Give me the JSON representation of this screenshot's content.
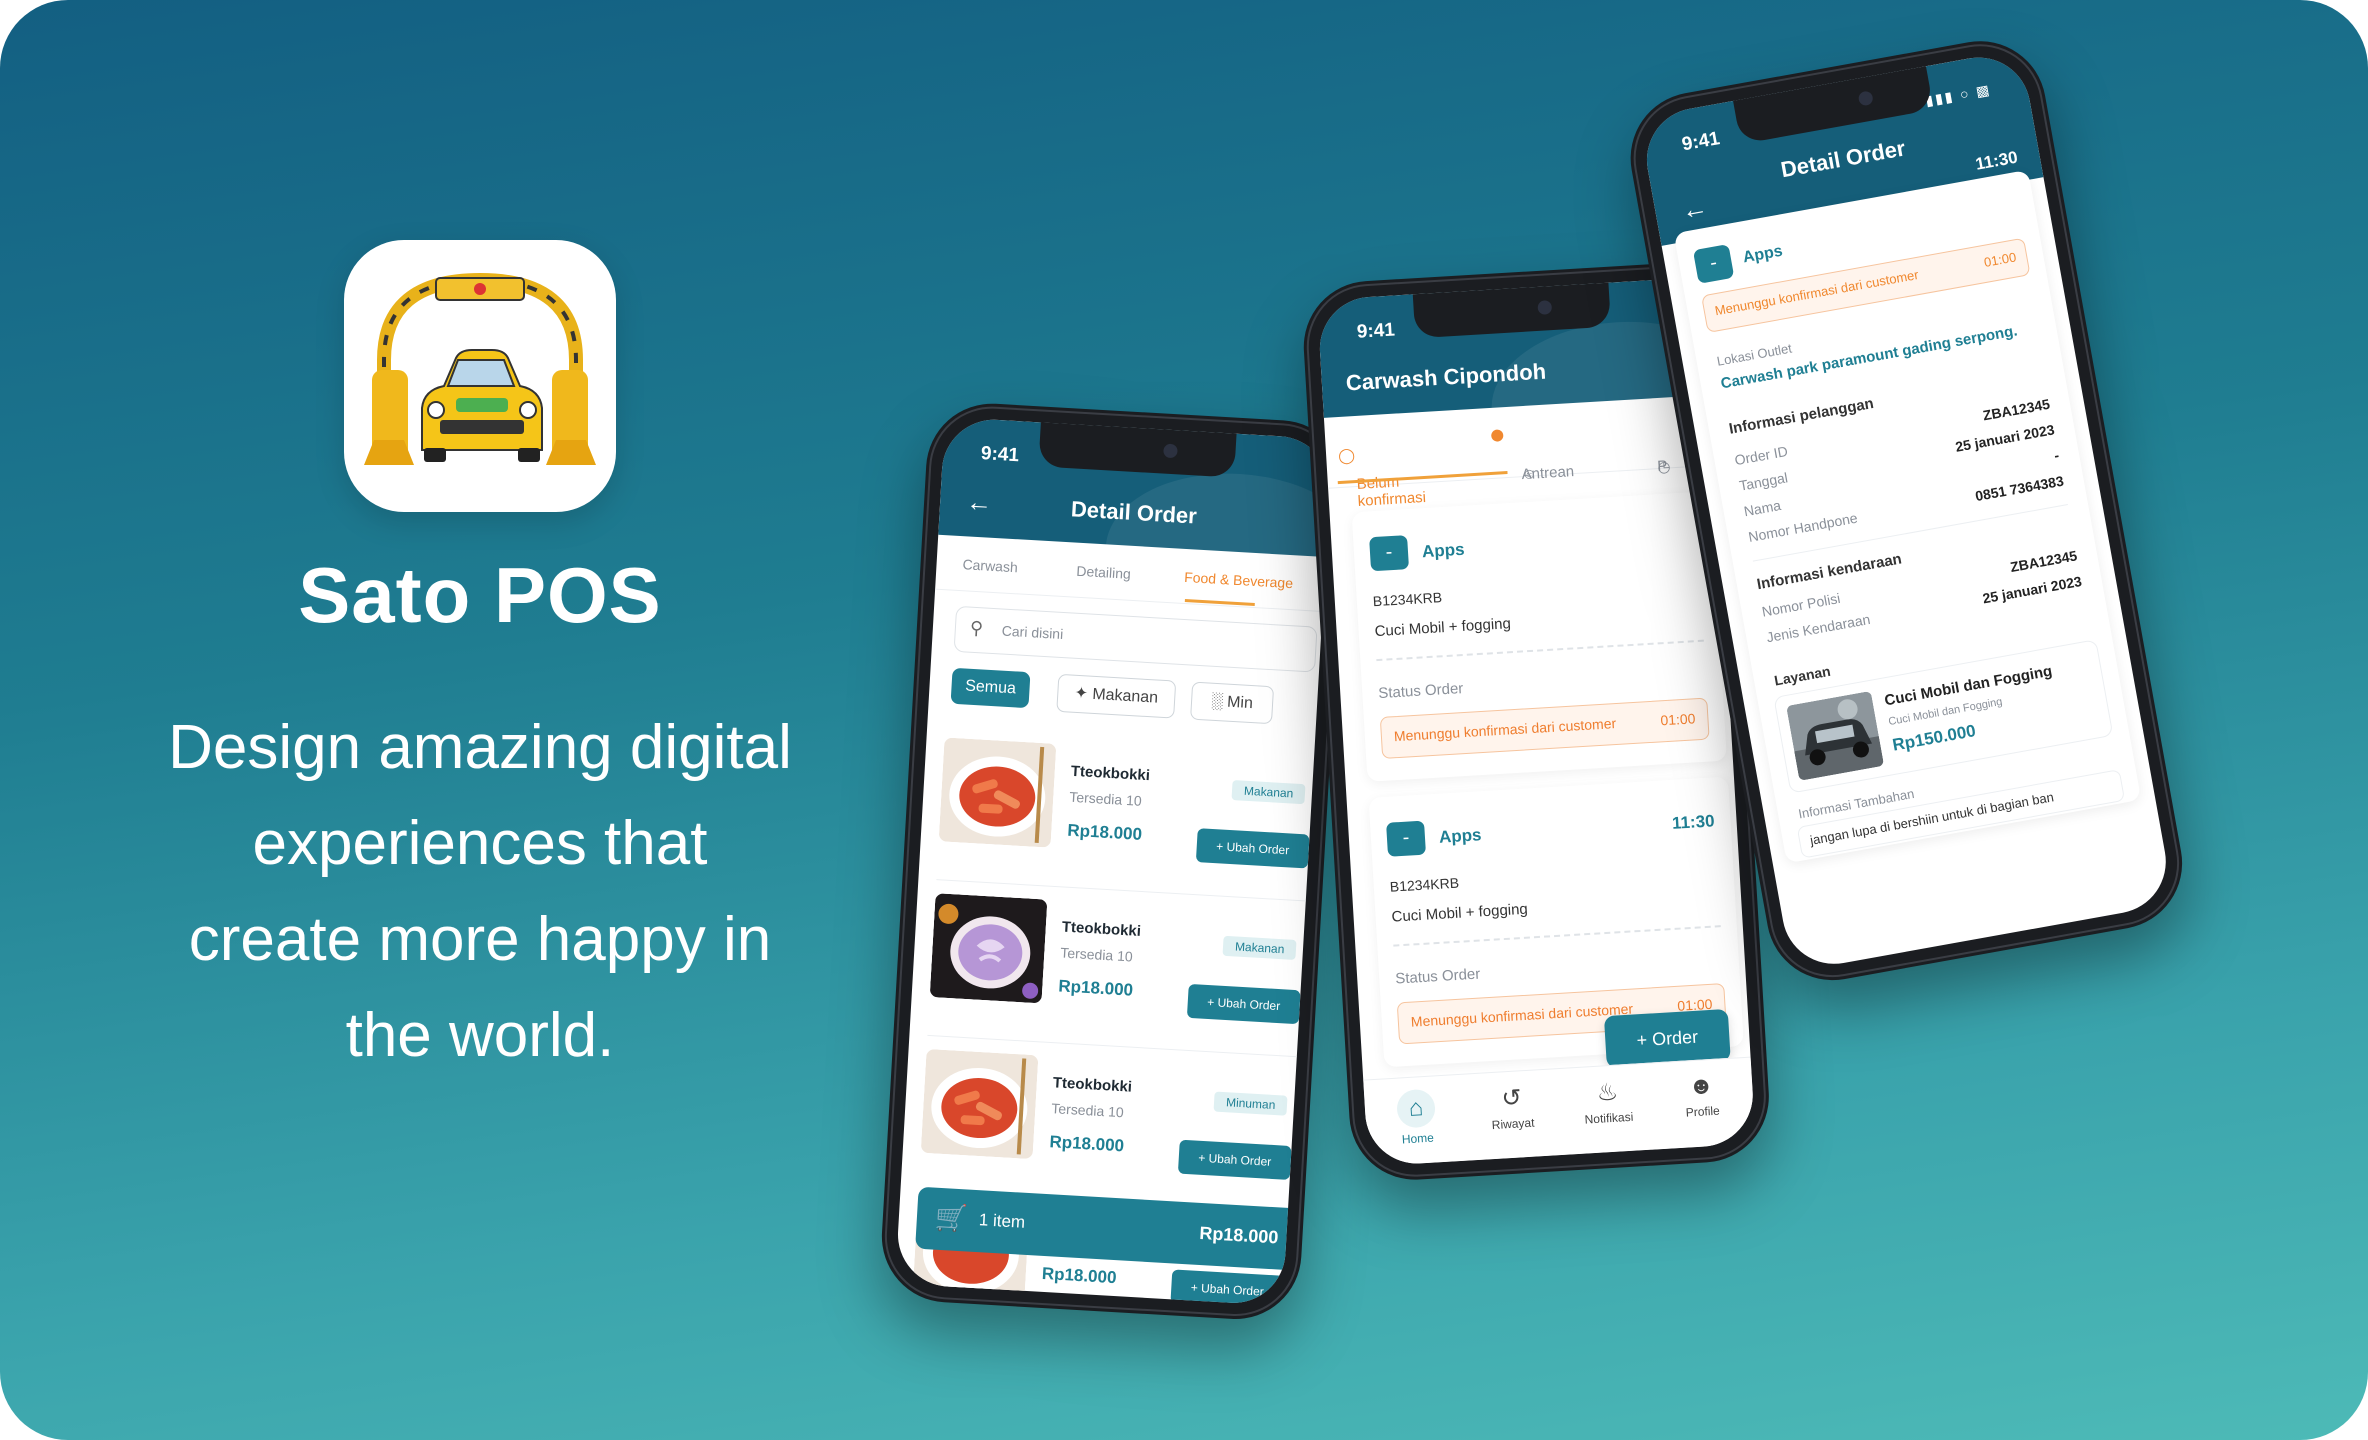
{
  "brand": {
    "app_name": "Sato POS",
    "tagline_lines": [
      "Design amazing digital",
      "experiences that",
      "create more happy in",
      "the world."
    ]
  },
  "phone1": {
    "time": "9:41",
    "title": "Detail Order",
    "tabs": [
      "Carwash",
      "Detailing",
      "Food & Beverage"
    ],
    "search_placeholder": "Cari disini",
    "filters": [
      "Semua",
      "Makanan",
      "Min"
    ],
    "items": [
      {
        "name": "Tteokbokki",
        "stock": "Tersedia 10",
        "price": "Rp18.000",
        "badge": "Makanan",
        "button": "+ Ubah Order",
        "image": "tteokbokki-bowl"
      },
      {
        "name": "Tteokbokki",
        "stock": "Tersedia 10",
        "price": "Rp18.000",
        "badge": "Makanan",
        "button": "+ Ubah Order",
        "image": "taro-latte"
      },
      {
        "name": "Tteokbokki",
        "stock": "Tersedia 10",
        "price": "Rp18.000",
        "badge": "Minuman",
        "button": "+ Ubah Order",
        "image": "tteokbokki-bowl"
      }
    ],
    "partial_item": {
      "price": "Rp18.000",
      "button": "+ Ubah Order"
    },
    "cart": {
      "count": "1 item",
      "total": "Rp18.000"
    }
  },
  "phone2": {
    "time": "9:41",
    "title": "Carwash Cipondoh",
    "tabs": [
      "Belum konfirmasi",
      "Antrean",
      "P"
    ],
    "orders": [
      {
        "source": "Apps",
        "time": "",
        "plate": "B1234KRB",
        "service": "Cuci Mobil + fogging",
        "status_label": "Status Order",
        "status": "Menunggu konfirmasi dari customer",
        "status_time": "01:00"
      },
      {
        "source": "Apps",
        "time": "11:30",
        "plate": "B1234KRB",
        "service": "Cuci Mobil + fogging",
        "status_label": "Status Order",
        "status": "Menunggu konfirmasi dari customer",
        "status_time": "01:00"
      }
    ],
    "fab": "+ Order",
    "nav": [
      "Home",
      "Riwayat",
      "Notifikasi",
      "Profile"
    ]
  },
  "phone3": {
    "time": "9:41",
    "title": "Detail Order",
    "clock": "11:30",
    "source": "Apps",
    "status": "Menunggu konfirmasi dari customer",
    "status_time": "01:00",
    "outlet_label": "Lokasi Outlet",
    "outlet": "Carwash park paramount gading serpong.",
    "customer_title": "Informasi pelanggan",
    "customer_rows": [
      {
        "k": "Order ID",
        "v": "ZBA12345"
      },
      {
        "k": "Tanggal",
        "v": "25 januari 2023"
      },
      {
        "k": "Nama",
        "v": "-"
      },
      {
        "k": "Nomor Handpone",
        "v": "0851 7364383"
      }
    ],
    "vehicle_title": "Informasi kendaraan",
    "vehicle_rows": [
      {
        "k": "Nomor Polisi",
        "v": "ZBA12345"
      },
      {
        "k": "Jenis Kendaraan",
        "v": "25 januari 2023"
      }
    ],
    "service_label": "Layanan",
    "service_name": "Cuci Mobil dan Fogging",
    "service_sub": "Cuci Mobil dan Fogging",
    "service_price": "Rp150.000",
    "extra_label": "Informasi Tambahan",
    "extra_text": "jangan lupa di bershiin untuk di bagian ban"
  },
  "colors": {
    "primary": "#1f7f93",
    "header": "#155e79",
    "accent": "#f0882f"
  }
}
